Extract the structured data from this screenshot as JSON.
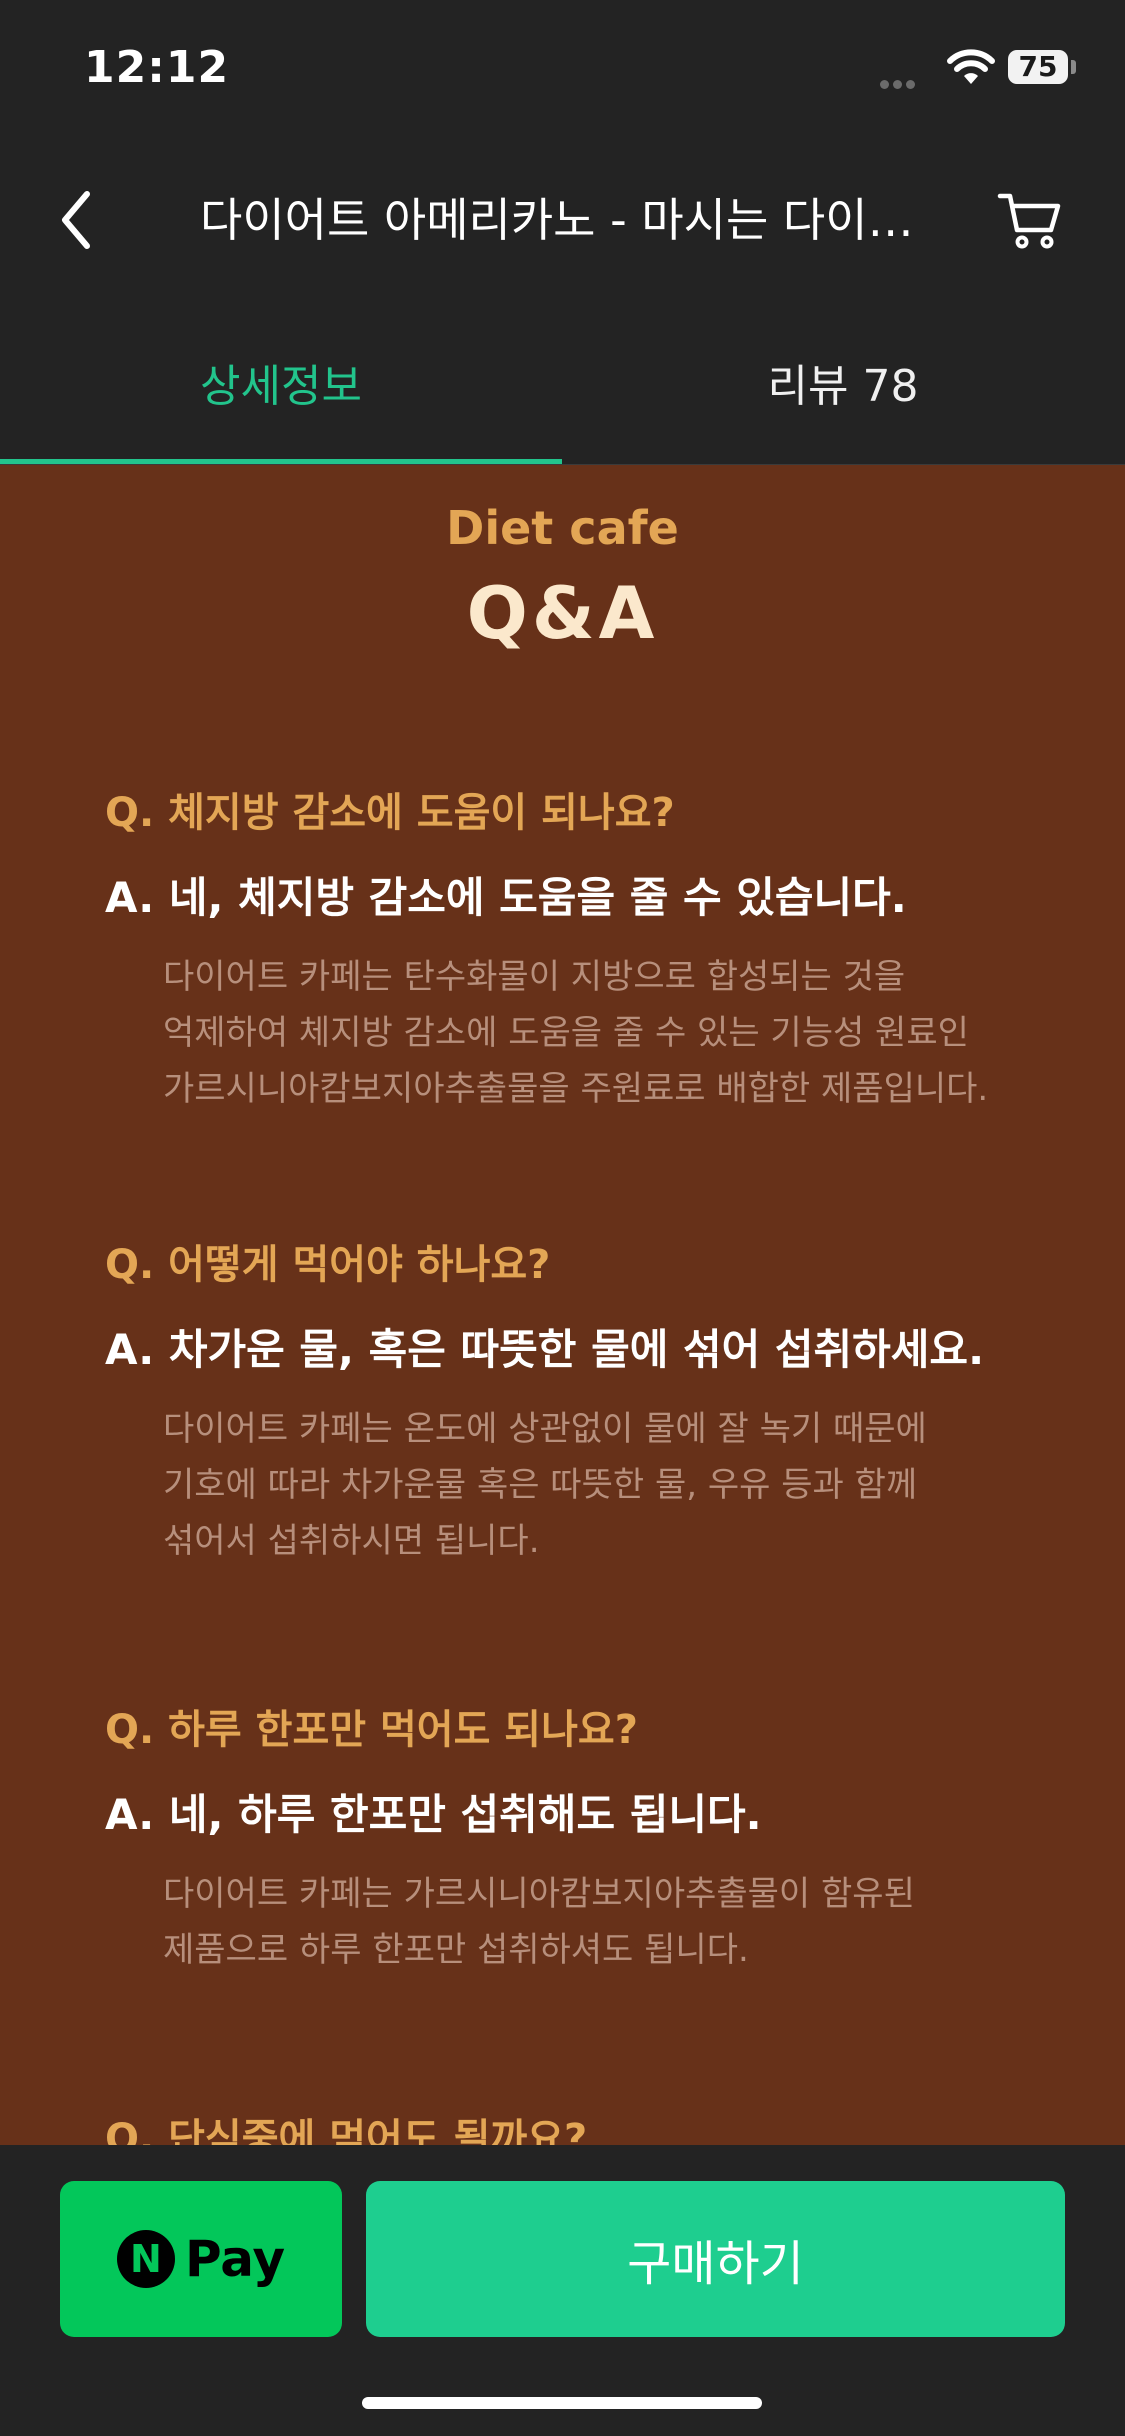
{
  "status_bar": {
    "time": "12:12",
    "battery": "75"
  },
  "nav": {
    "title": "다이어트 아메리카노 - 마시는 다이어트 커피",
    "back_icon": "chevron-left-icon",
    "cart_icon": "cart-icon"
  },
  "tabs": [
    {
      "label": "상세정보",
      "active": true
    },
    {
      "label": "리뷰 78",
      "active": false
    }
  ],
  "content": {
    "brand_sub": "Diet cafe",
    "brand_title": "Q&A",
    "qa": [
      {
        "q": "Q. 체지방 감소에 도움이 되나요?",
        "a": "A. 네, 체지방 감소에 도움을 줄 수 있습니다.",
        "body": [
          "다이어트 카페는 탄수화물이 지방으로 합성되는 것을",
          "억제하여 체지방 감소에 도움을 줄 수 있는 기능성 원료인",
          "가르시니아캄보지아추출물을 주원료로 배합한 제품입니다."
        ]
      },
      {
        "q": "Q. 어떻게 먹어야 하나요?",
        "a": "A. 차가운 물, 혹은 따뜻한 물에 섞어 섭취하세요.",
        "body": [
          "다이어트 카페는 온도에 상관없이 물에 잘 녹기 때문에",
          "기호에 따라 차가운물 혹은 따뜻한 물, 우유 등과 함께",
          "섞어서 섭취하시면 됩니다."
        ]
      },
      {
        "q": "Q. 하루 한포만 먹어도 되나요?",
        "a": "A. 네, 하루 한포만 섭취해도 됩니다.",
        "body": [
          "다이어트 카페는 가르시니아캄보지아추출물이 함유된",
          "제품으로 하루 한포만 섭취하셔도 됩니다."
        ]
      },
      {
        "q": "Q. 단식중에 먹어도 될까요?",
        "a": "",
        "body": []
      }
    ]
  },
  "bottom": {
    "npay_mark": "N",
    "npay_label": "Pay",
    "buy_label": "구매하기"
  },
  "colors": {
    "accent": "#22c48c",
    "content_bg": "#673119",
    "question": "#e3a655",
    "npay": "#03c75a",
    "buy": "#1ece8f"
  }
}
